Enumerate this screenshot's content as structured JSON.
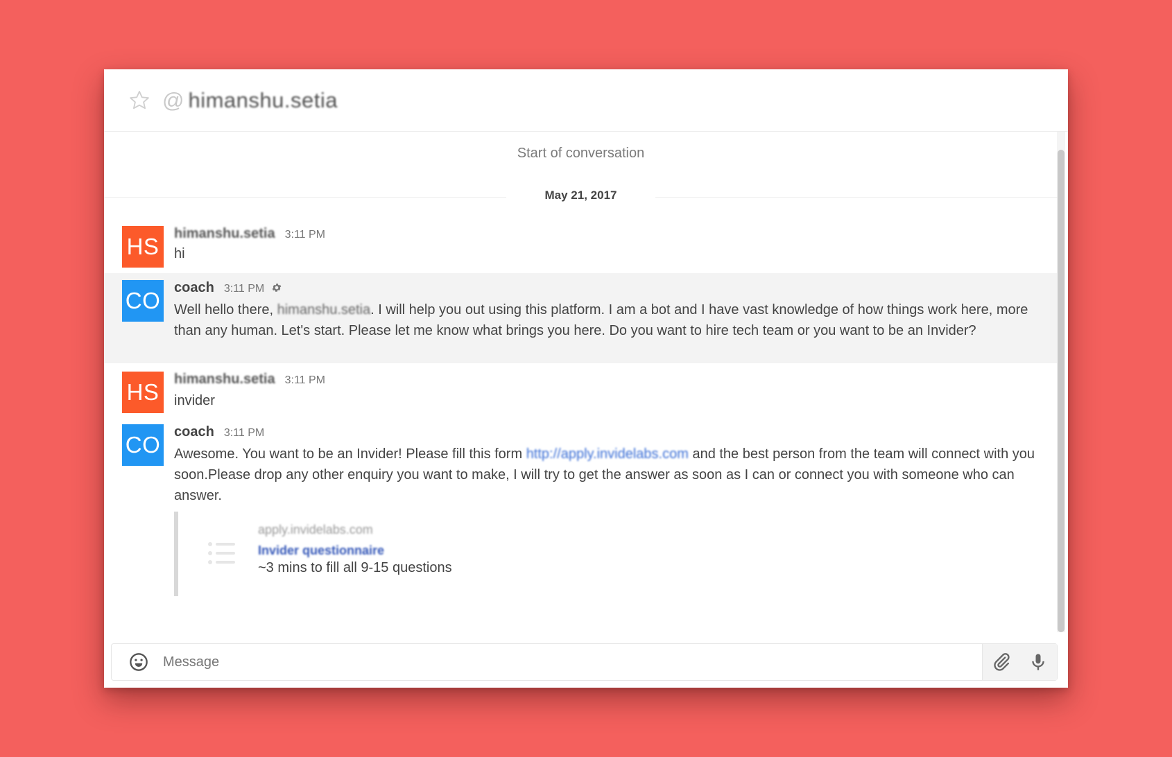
{
  "header": {
    "at_sign": "@",
    "room_name": "himanshu.setia"
  },
  "conversation": {
    "start_label": "Start of conversation",
    "date_label": "May 21, 2017"
  },
  "messages": [
    {
      "avatar": "HS",
      "avatar_color": "#fc5a2a",
      "author": "himanshu.setia",
      "time": "3:11 PM",
      "text": "hi"
    },
    {
      "avatar": "CO",
      "avatar_color": "#2196f3",
      "author": "coach",
      "time": "3:11 PM",
      "text_before": "Well hello there, ",
      "redacted_name": "himanshu.setia",
      "text_after": ". I will help you out using this platform. I am a bot and I have vast knowledge of how things work here, more than any human. Let's start. Please let me know what brings you here. Do you want to hire tech team or you want to be an Invider?"
    },
    {
      "avatar": "HS",
      "avatar_color": "#fc5a2a",
      "author": "himanshu.setia",
      "time": "3:11 PM",
      "text": "invider"
    },
    {
      "avatar": "CO",
      "avatar_color": "#2196f3",
      "author": "coach",
      "time": "3:11 PM",
      "text_before": "Awesome. You want to be an Invider! Please fill this form ",
      "link": "http://apply.invidelabs.com",
      "text_after": " and the best person from the team will connect with you soon.Please drop any other enquiry you want to make, I will try to get the answer as soon as I can or connect you with someone who can answer.",
      "attachment": {
        "host": "apply.invidelabs.com",
        "title": "Invider questionnaire",
        "description": "~3 mins to fill all 9-15 questions"
      }
    }
  ],
  "composer": {
    "placeholder": "Message"
  },
  "icons": {
    "favorite": "star-icon",
    "bot_settings": "gear-icon",
    "emoji": "emoji-icon",
    "attach": "paperclip-icon",
    "voice": "microphone-icon",
    "attachment": "list-icon"
  }
}
